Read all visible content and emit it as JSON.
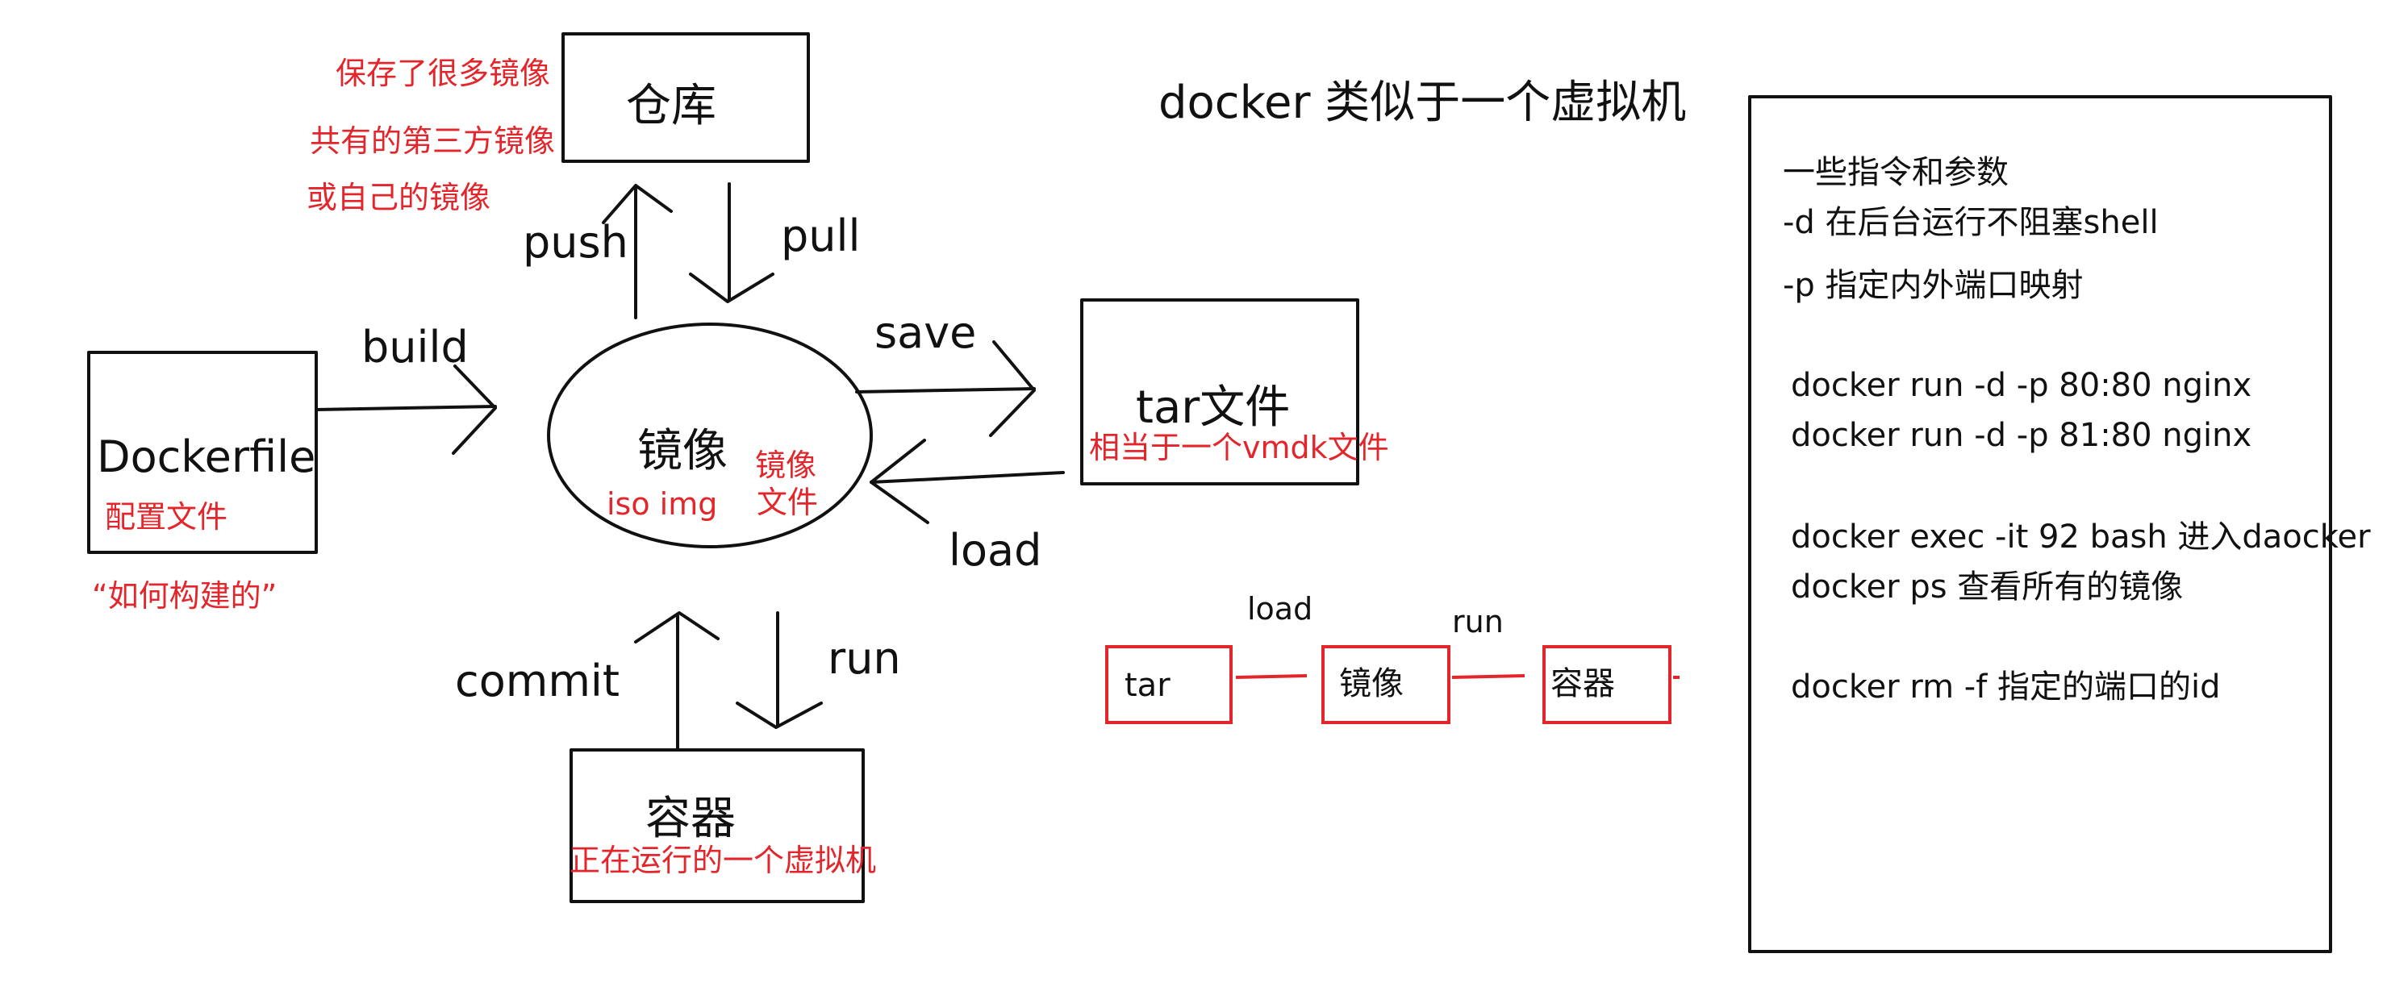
{
  "colors": {
    "ink": "#111111",
    "annotation": "#e3262b"
  },
  "title": "docker 类似于一个虚拟机",
  "nodes": {
    "warehouse": {
      "label": "仓库",
      "notes": [
        "保存了很多镜像",
        "共有的第三方镜像",
        "或自己的镜像"
      ]
    },
    "image": {
      "label": "镜像",
      "note_left": "iso img",
      "note_right_line1": "镜像",
      "note_right_line2": "文件"
    },
    "dockerfile": {
      "label": "Dockerfile",
      "note": "配置文件",
      "quote": "“如何构建的”"
    },
    "tar": {
      "label": "tar文件",
      "note": "相当于一个vmdk文件"
    },
    "container": {
      "label": "容器",
      "note": "正在运行的一个虚拟机"
    }
  },
  "arrows": {
    "push": "push",
    "pull": "pull",
    "build": "build",
    "save": "save",
    "load": "load",
    "commit": "commit",
    "run": "run"
  },
  "flow": {
    "steps": [
      "tar",
      "镜像",
      "容器"
    ],
    "labels": [
      "load",
      "run"
    ]
  },
  "commands_panel": {
    "lines": [
      "一些指令和参数",
      "-d 在后台运行不阻塞shell",
      "-p 指定内外端口映射",
      "docker run -d -p 80:80 nginx",
      "docker run -d -p 81:80 nginx",
      "docker exec -it 92 bash 进入daocker",
      "docker ps 查看所有的镜像",
      "docker rm -f 指定的端口的id"
    ]
  }
}
